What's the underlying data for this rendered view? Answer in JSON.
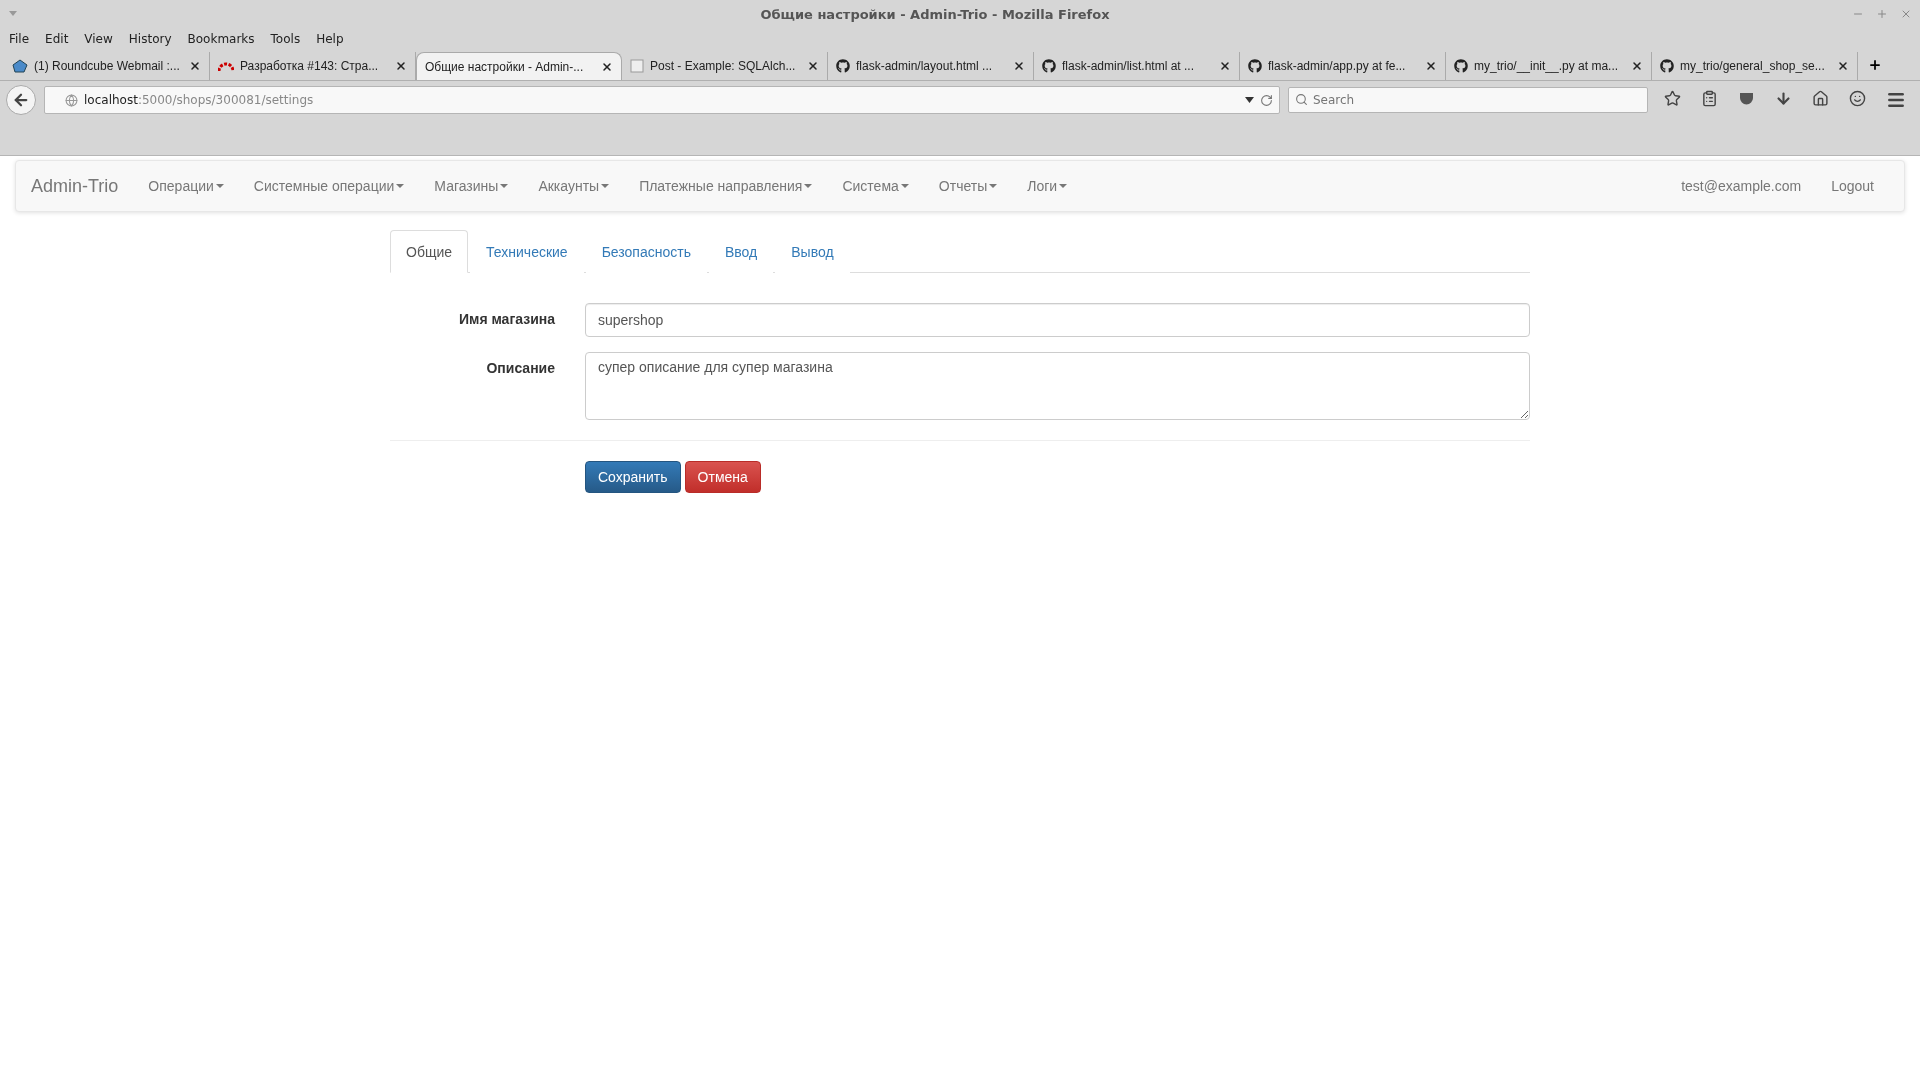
{
  "window": {
    "title": "Общие настройки - Admin-Trio - Mozilla Firefox"
  },
  "menu": [
    "File",
    "Edit",
    "View",
    "History",
    "Bookmarks",
    "Tools",
    "Help"
  ],
  "browser_tabs": [
    {
      "title": "(1) Roundcube Webmail :...",
      "kind": "mail",
      "selected": false
    },
    {
      "title": "Разработка #143: Стра...",
      "kind": "arc",
      "selected": false
    },
    {
      "title": "Общие настройки - Admin-...",
      "kind": "plain",
      "selected": true
    },
    {
      "title": "Post - Example: SQLAlch...",
      "kind": "page",
      "selected": false
    },
    {
      "title": "flask-admin/layout.html ...",
      "kind": "github",
      "selected": false
    },
    {
      "title": "flask-admin/list.html at ...",
      "kind": "github",
      "selected": false
    },
    {
      "title": "flask-admin/app.py at fe...",
      "kind": "github",
      "selected": false
    },
    {
      "title": "my_trio/__init__.py at ma...",
      "kind": "github",
      "selected": false
    },
    {
      "title": "my_trio/general_shop_se...",
      "kind": "github",
      "selected": false
    }
  ],
  "url": {
    "host": "localhost",
    "path": ":5000/shops/300081/settings"
  },
  "search": {
    "placeholder": "Search"
  },
  "navbar": {
    "brand": "Admin-Trio",
    "items": [
      "Операции",
      "Системные операции",
      "Магазины",
      "Аккаунты",
      "Платежные направления",
      "Система",
      "Отчеты",
      "Логи"
    ],
    "user": "test@example.com",
    "logout": "Logout"
  },
  "settings_tabs": [
    {
      "label": "Общие",
      "selected": true
    },
    {
      "label": "Технические",
      "selected": false
    },
    {
      "label": "Безопасность",
      "selected": false
    },
    {
      "label": "Ввод",
      "selected": false
    },
    {
      "label": "Вывод",
      "selected": false
    }
  ],
  "form": {
    "fields": [
      {
        "label": "Имя магазина",
        "kind": "input",
        "value": "supershop"
      },
      {
        "label": "Описание",
        "kind": "textarea",
        "value": "супер описание для супер магазина"
      }
    ],
    "save": "Сохранить",
    "cancel": "Отмена"
  }
}
